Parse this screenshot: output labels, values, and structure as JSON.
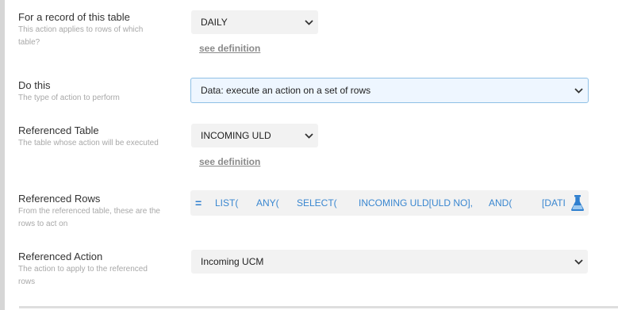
{
  "fields": {
    "record_table": {
      "label": "For a record of this table",
      "desc_line1": "This action applies to rows of which",
      "desc_line2": "table?",
      "value": "DAILY",
      "link": "see definition"
    },
    "do_this": {
      "label": "Do this",
      "desc": "The type of action to perform",
      "value": "Data: execute an action on a set of rows"
    },
    "referenced_table": {
      "label": "Referenced Table",
      "desc": "The table whose action will be executed",
      "value": "INCOMING ULD",
      "link": "see definition"
    },
    "referenced_rows": {
      "label": "Referenced Rows",
      "desc_line1": "From the referenced table, these are the",
      "desc_line2": "rows to act on",
      "expr_symbol": "=",
      "tokens": [
        "LIST(",
        "ANY(",
        "SELECT(",
        "INCOMING ULD[ULD NO],",
        "AND(",
        "[DATI"
      ]
    },
    "referenced_action": {
      "label": "Referenced Action",
      "desc_line1": "The action to apply to the referenced",
      "desc_line2": "rows",
      "value": "Incoming UCM"
    }
  },
  "icons": {
    "dropdown": "chevron-down-icon",
    "test": "flask-icon"
  },
  "colors": {
    "accent": "#3a87d0",
    "active_border": "#8fc0e6",
    "field_bg": "#f2f2f2"
  }
}
